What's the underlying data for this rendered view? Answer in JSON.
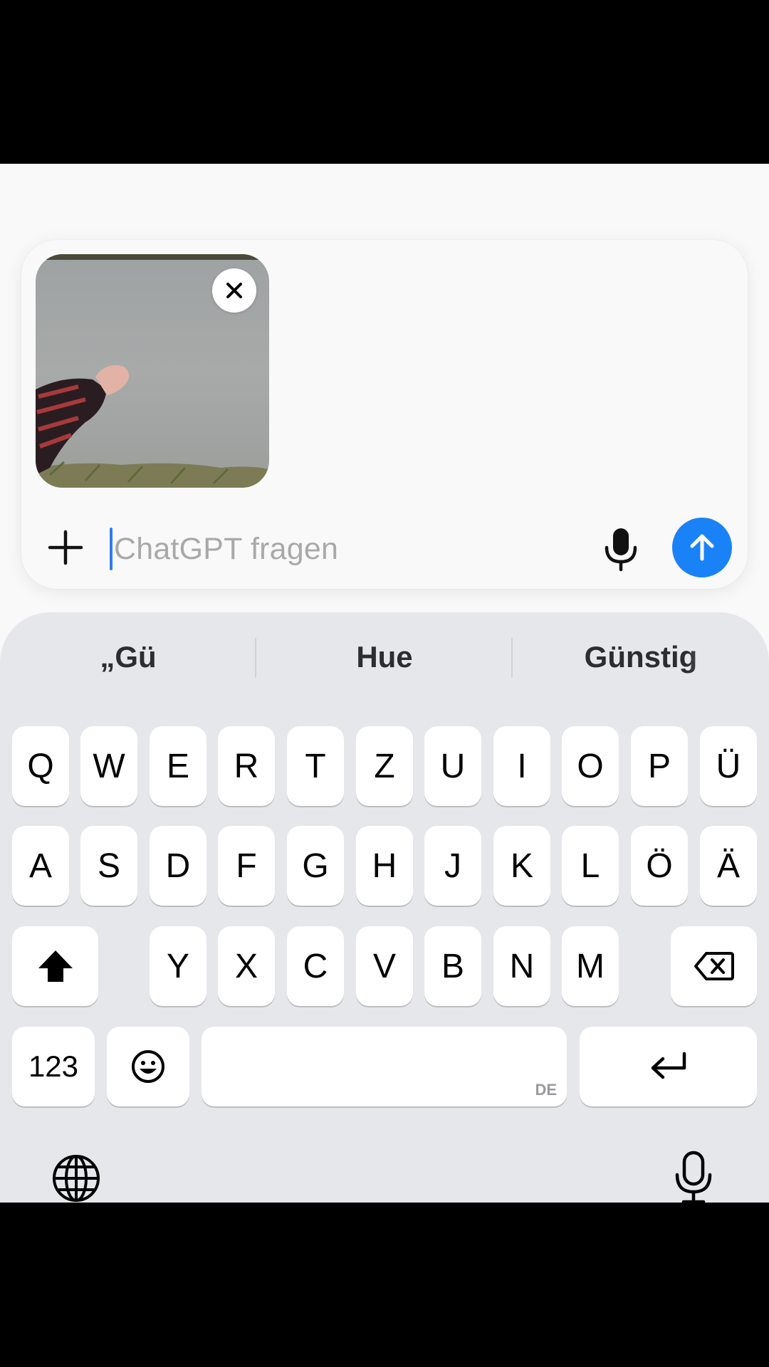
{
  "composer": {
    "placeholder": "ChatGPT fragen",
    "attachment_icon": "close-icon",
    "add_icon": "plus-icon",
    "mic_icon": "microphone-icon",
    "send_icon": "arrow-up-icon",
    "accent_color": "#1a82f7"
  },
  "keyboard": {
    "suggestions": [
      "„Gü",
      "Hue",
      "Günstig"
    ],
    "rows": [
      [
        "Q",
        "W",
        "E",
        "R",
        "T",
        "Z",
        "U",
        "I",
        "O",
        "P",
        "Ü"
      ],
      [
        "A",
        "S",
        "D",
        "F",
        "G",
        "H",
        "J",
        "K",
        "L",
        "Ö",
        "Ä"
      ],
      [
        "Y",
        "X",
        "C",
        "V",
        "B",
        "N",
        "M"
      ]
    ],
    "numbers_label": "123",
    "space_lang": "DE",
    "shift_icon": "shift-icon",
    "backspace_icon": "backspace-icon",
    "emoji_icon": "emoji-icon",
    "return_icon": "return-icon",
    "globe_icon": "globe-icon",
    "dictation_icon": "microphone-icon"
  }
}
